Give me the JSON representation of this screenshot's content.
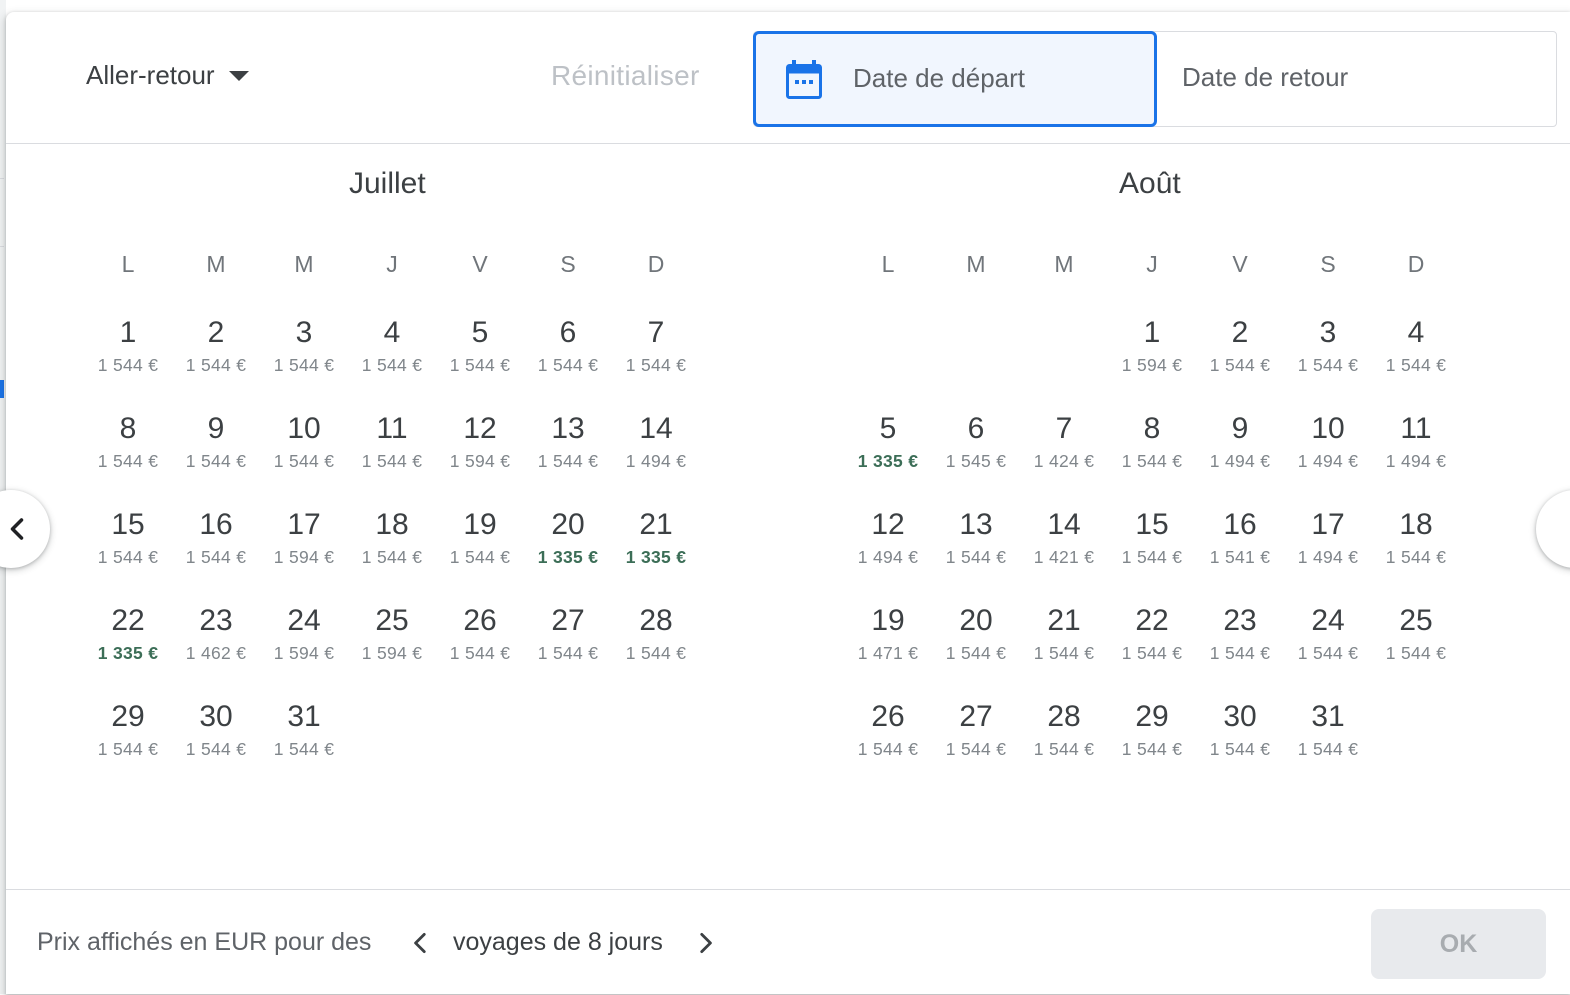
{
  "header": {
    "trip_type": "Aller-retour",
    "reset_label": "Réinitialiser",
    "departure_placeholder": "Date de départ",
    "return_placeholder": "Date de retour"
  },
  "weekdays": [
    "L",
    "M",
    "M",
    "J",
    "V",
    "S",
    "D"
  ],
  "months": [
    {
      "name": "Juillet",
      "offset": 0,
      "days": [
        {
          "d": "1",
          "p": "1 544 €"
        },
        {
          "d": "2",
          "p": "1 544 €"
        },
        {
          "d": "3",
          "p": "1 544 €"
        },
        {
          "d": "4",
          "p": "1 544 €"
        },
        {
          "d": "5",
          "p": "1 544 €"
        },
        {
          "d": "6",
          "p": "1 544 €"
        },
        {
          "d": "7",
          "p": "1 544 €"
        },
        {
          "d": "8",
          "p": "1 544 €"
        },
        {
          "d": "9",
          "p": "1 544 €"
        },
        {
          "d": "10",
          "p": "1 544 €"
        },
        {
          "d": "11",
          "p": "1 544 €"
        },
        {
          "d": "12",
          "p": "1 594 €"
        },
        {
          "d": "13",
          "p": "1 544 €"
        },
        {
          "d": "14",
          "p": "1 494 €"
        },
        {
          "d": "15",
          "p": "1 544 €"
        },
        {
          "d": "16",
          "p": "1 544 €"
        },
        {
          "d": "17",
          "p": "1 594 €"
        },
        {
          "d": "18",
          "p": "1 544 €"
        },
        {
          "d": "19",
          "p": "1 544 €"
        },
        {
          "d": "20",
          "p": "1 335 €",
          "low": true
        },
        {
          "d": "21",
          "p": "1 335 €",
          "low": true
        },
        {
          "d": "22",
          "p": "1 335 €",
          "low": true
        },
        {
          "d": "23",
          "p": "1 462 €"
        },
        {
          "d": "24",
          "p": "1 594 €"
        },
        {
          "d": "25",
          "p": "1 594 €"
        },
        {
          "d": "26",
          "p": "1 544 €"
        },
        {
          "d": "27",
          "p": "1 544 €"
        },
        {
          "d": "28",
          "p": "1 544 €"
        },
        {
          "d": "29",
          "p": "1 544 €"
        },
        {
          "d": "30",
          "p": "1 544 €"
        },
        {
          "d": "31",
          "p": "1 544 €"
        }
      ]
    },
    {
      "name": "Août",
      "offset": 3,
      "days": [
        {
          "d": "1",
          "p": "1 594 €"
        },
        {
          "d": "2",
          "p": "1 544 €"
        },
        {
          "d": "3",
          "p": "1 544 €"
        },
        {
          "d": "4",
          "p": "1 544 €"
        },
        {
          "d": "5",
          "p": "1 335 €",
          "low": true
        },
        {
          "d": "6",
          "p": "1 545 €"
        },
        {
          "d": "7",
          "p": "1 424 €"
        },
        {
          "d": "8",
          "p": "1 544 €"
        },
        {
          "d": "9",
          "p": "1 494 €"
        },
        {
          "d": "10",
          "p": "1 494 €"
        },
        {
          "d": "11",
          "p": "1 494 €"
        },
        {
          "d": "12",
          "p": "1 494 €"
        },
        {
          "d": "13",
          "p": "1 544 €"
        },
        {
          "d": "14",
          "p": "1 421 €"
        },
        {
          "d": "15",
          "p": "1 544 €"
        },
        {
          "d": "16",
          "p": "1 541 €"
        },
        {
          "d": "17",
          "p": "1 494 €"
        },
        {
          "d": "18",
          "p": "1 544 €"
        },
        {
          "d": "19",
          "p": "1 471 €"
        },
        {
          "d": "20",
          "p": "1 544 €"
        },
        {
          "d": "21",
          "p": "1 544 €"
        },
        {
          "d": "22",
          "p": "1 544 €"
        },
        {
          "d": "23",
          "p": "1 544 €"
        },
        {
          "d": "24",
          "p": "1 544 €"
        },
        {
          "d": "25",
          "p": "1 544 €"
        },
        {
          "d": "26",
          "p": "1 544 €"
        },
        {
          "d": "27",
          "p": "1 544 €"
        },
        {
          "d": "28",
          "p": "1 544 €"
        },
        {
          "d": "29",
          "p": "1 544 €"
        },
        {
          "d": "30",
          "p": "1 544 €"
        },
        {
          "d": "31",
          "p": "1 544 €"
        }
      ]
    }
  ],
  "footer": {
    "prefix": "Prix affichés en EUR pour des",
    "duration": "voyages de 8 jours",
    "ok_label": "OK"
  },
  "colors": {
    "accent": "#1a73e8",
    "low_price": "#3c6e57"
  },
  "icons": {
    "trip_caret": "caret-down-icon",
    "calendar": "calendar-icon",
    "prev_month": "chevron-left-icon",
    "next_month": "chevron-right-icon",
    "duration_prev": "chevron-left-icon",
    "duration_next": "chevron-right-icon"
  }
}
